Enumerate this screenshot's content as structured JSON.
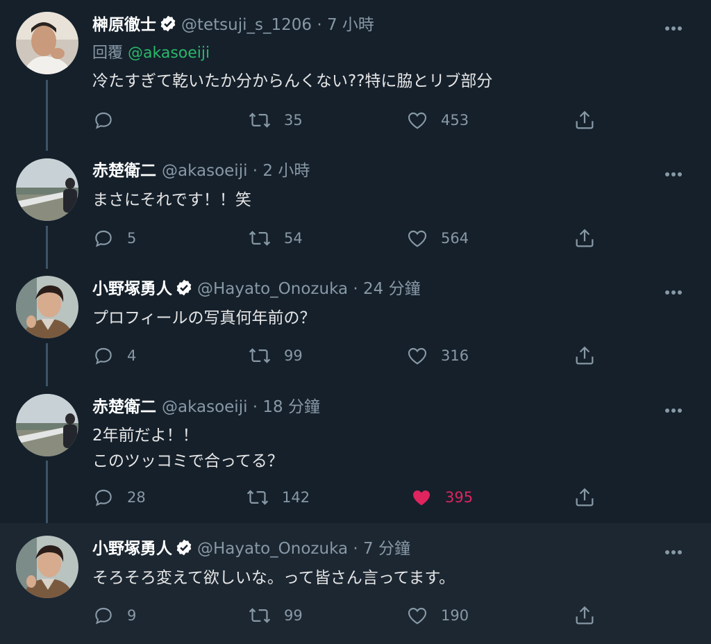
{
  "tweets": [
    {
      "name": "榊原徹士",
      "verified": true,
      "handle": "@tetsuji_s_1206",
      "time": "7 小時",
      "reply_label": "回覆",
      "reply_mention": "@akasoeiji",
      "text": "冷たすぎて乾いたか分からんくない??特に脇とリブ部分",
      "replies": "",
      "retweets": "35",
      "likes": "453",
      "liked": false,
      "avatar": "portrait-man-smiling"
    },
    {
      "name": "赤楚衛二",
      "verified": false,
      "handle": "@akasoeiji",
      "time": "2 小時",
      "text": "まさにそれです！！笑",
      "replies": "5",
      "retweets": "54",
      "likes": "564",
      "liked": false,
      "avatar": "man-at-riverside"
    },
    {
      "name": "小野塚勇人",
      "verified": true,
      "handle": "@Hayato_Onozuka",
      "time": "24 分鐘",
      "text": "プロフィールの写真何年前の？",
      "replies": "4",
      "retweets": "99",
      "likes": "316",
      "liked": false,
      "avatar": "portrait-man-brown-jacket"
    },
    {
      "name": "赤楚衛二",
      "verified": false,
      "handle": "@akasoeiji",
      "time": "18 分鐘",
      "text": "2年前だよ！！\nこのツッコミで合ってる？",
      "replies": "28",
      "retweets": "142",
      "likes": "395",
      "liked": true,
      "avatar": "man-at-riverside"
    },
    {
      "name": "小野塚勇人",
      "verified": true,
      "handle": "@Hayato_Onozuka",
      "time": "7 分鐘",
      "text": "そろそろ変えて欲しいな。って皆さん言ってます。",
      "replies": "9",
      "retweets": "99",
      "likes": "190",
      "liked": false,
      "avatar": "portrait-man-brown-jacket"
    }
  ],
  "colors": {
    "background": "#15202b",
    "highlight_row": "#1c2732",
    "secondary_text": "#8899a6",
    "mention": "#2ab86a",
    "like_active": "#e0245e"
  }
}
